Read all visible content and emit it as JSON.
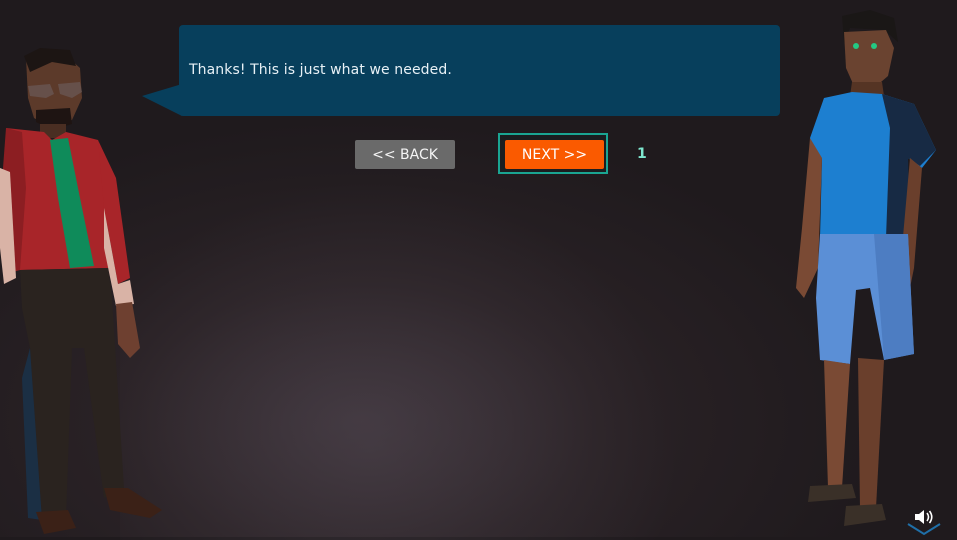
{
  "dialog": {
    "text": "Thanks! This is just what we needed."
  },
  "buttons": {
    "back_label": "<< BACK",
    "next_label": "NEXT >>"
  },
  "step": {
    "number": "1"
  },
  "colors": {
    "dialog_bg": "#073f5c",
    "next_button": "#fa5a00",
    "back_button": "#6a6a6a",
    "highlight_frame": "#1aa592",
    "badge": "#7ee7cf"
  },
  "icons": {
    "sound": "speaker-icon"
  }
}
